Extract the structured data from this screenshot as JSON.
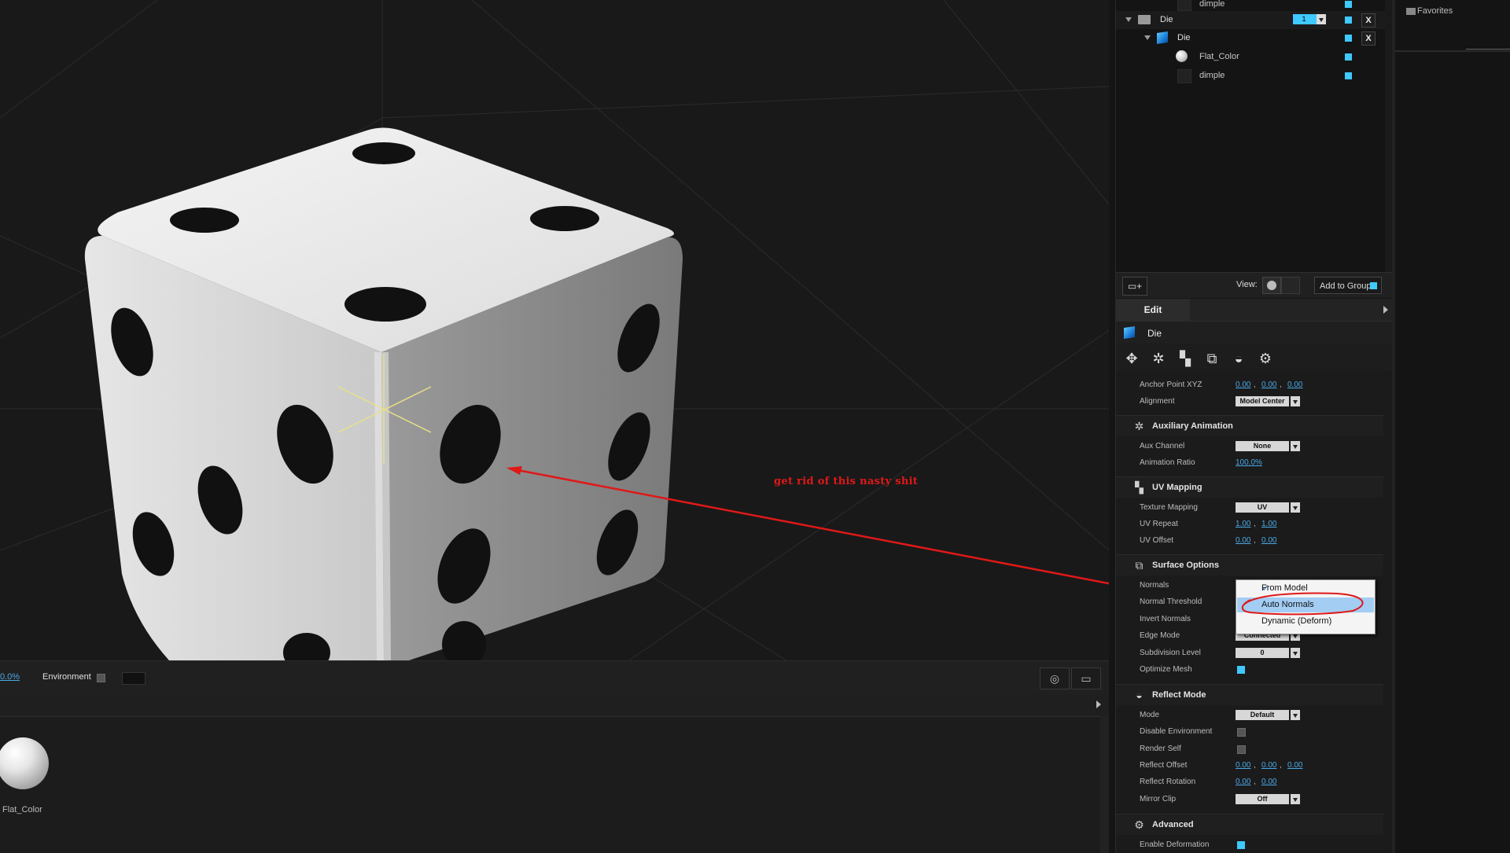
{
  "layers": {
    "rows": [
      {
        "name": "dimple",
        "type": "texture"
      },
      {
        "name": "Die",
        "type": "group",
        "count": "1"
      },
      {
        "name": "Die",
        "type": "model"
      },
      {
        "name": "Flat_Color",
        "type": "material"
      },
      {
        "name": "dimple",
        "type": "texture"
      }
    ],
    "view_label": "View:",
    "add_to_group": "Add to Group"
  },
  "edit": {
    "tab": "Edit",
    "object_name": "Die",
    "anchor": {
      "label": "Anchor Point XYZ",
      "x": "0.00",
      "y": "0.00",
      "z": "0.00"
    },
    "alignment": {
      "label": "Alignment",
      "value": "Model Center"
    },
    "aux_section": "Auxiliary Animation",
    "aux_channel": {
      "label": "Aux Channel",
      "value": "None"
    },
    "animation_ratio": {
      "label": "Animation Ratio",
      "value": "100.0%"
    },
    "uv_section": "UV Mapping",
    "texture_mapping": {
      "label": "Texture Mapping",
      "value": "UV"
    },
    "uv_repeat": {
      "label": "UV Repeat",
      "u": "1.00",
      "v": "1.00"
    },
    "uv_offset": {
      "label": "UV Offset",
      "u": "0.00",
      "v": "0.00"
    },
    "surface_section": "Surface Options",
    "normals_label": "Normals",
    "normal_threshold_label": "Normal Threshold",
    "invert_normals_label": "Invert Normals",
    "edge_mode": {
      "label": "Edge Mode",
      "value": "Connected"
    },
    "subdivision": {
      "label": "Subdivision Level",
      "value": "0"
    },
    "optimize_mesh_label": "Optimize Mesh",
    "reflect_section": "Reflect Mode",
    "mode": {
      "label": "Mode",
      "value": "Default"
    },
    "disable_env_label": "Disable Environment",
    "render_self_label": "Render Self",
    "reflect_offset": {
      "label": "Reflect Offset",
      "x": "0.00",
      "y": "0.00",
      "z": "0.00"
    },
    "reflect_rotation": {
      "label": "Reflect Rotation",
      "x": "0.00",
      "y": "0.00"
    },
    "mirror_clip": {
      "label": "Mirror Clip",
      "value": "Off"
    },
    "advanced_section": "Advanced",
    "enable_deformation_label": "Enable Deformation"
  },
  "normals_popup": {
    "options": [
      "From Model",
      "Auto Normals",
      "Dynamic (Deform)"
    ],
    "checked": "From Model",
    "highlighted": "Auto Normals"
  },
  "viewport": {
    "annotation": "get rid of this nasty shit",
    "zoom_value": "0.0%",
    "environment_label": "Environment"
  },
  "materials": {
    "items": [
      {
        "name": "Flat_Color"
      }
    ]
  },
  "right_panel": {
    "favorites": "Favorites"
  },
  "colors": {
    "accent": "#3fc9ff",
    "annotation_red": "#e01818",
    "link_blue": "#4aa8e8"
  }
}
